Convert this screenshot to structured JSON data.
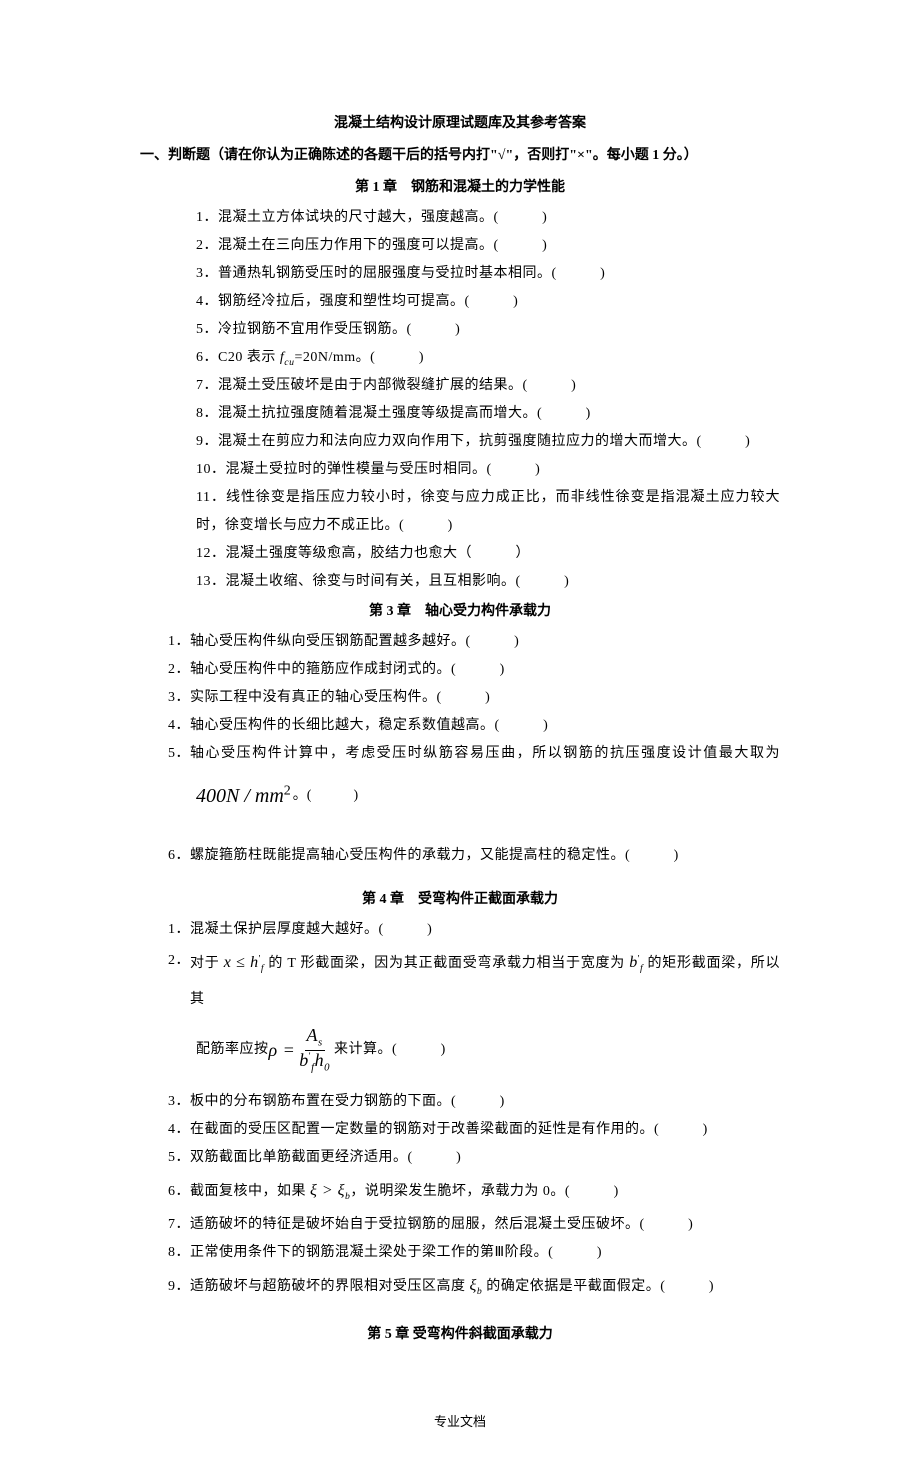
{
  "title": "混凝土结构设计原理试题库及其参考答案",
  "instruction": "一、判断题（请在你认为正确陈述的各题干后的括号内打\"√\"，否则打\"×\"。每小题 1 分。）",
  "chapter1": "第 1 章　钢筋和混凝土的力学性能",
  "c1": {
    "q1": "1．混凝土立方体试块的尺寸越大，强度越高。(　　　)",
    "q2": "2．混凝土在三向压力作用下的强度可以提高。(　　　)",
    "q3": "3．普通热轧钢筋受压时的屈服强度与受拉时基本相同。(　　　)",
    "q4": "4．钢筋经冷拉后，强度和塑性均可提高。(　　　)",
    "q5": "5．冷拉钢筋不宜用作受压钢筋。(　　　)",
    "q6_a": "6．C20 表示 ",
    "q6_fcu": "f",
    "q6_sub": "cu",
    "q6_b": "=20N/mm。(　　　)",
    "q7": "7．混凝土受压破坏是由于内部微裂缝扩展的结果。(　　　)",
    "q8": "8．混凝土抗拉强度随着混凝土强度等级提高而增大。(　　　)",
    "q9": "9．混凝土在剪应力和法向应力双向作用下，抗剪强度随拉应力的增大而增大。(　　　)",
    "q10": "10．混凝土受拉时的弹性模量与受压时相同。(　　　)",
    "q11": "11．线性徐变是指压应力较小时，徐变与应力成正比，而非线性徐变是指混凝土应力较大时，徐变增长与应力不成正比。(　　　)",
    "q12": "12．混凝土强度等级愈高，胶结力也愈大（　　　）",
    "q13": "13．混凝土收缩、徐变与时间有关，且互相影响。(　　　)"
  },
  "chapter3": "第 3 章　轴心受力构件承载力",
  "c3": {
    "q1": "轴心受压构件纵向受压钢筋配置越多越好。(　　　)",
    "q2": "轴心受压构件中的箍筋应作成封闭式的。(　　　)",
    "q3": "实际工程中没有真正的轴心受压构件。(　　　)",
    "q4": "轴心受压构件的长细比越大，稳定系数值越高。(　　　)",
    "q5_a": "轴心受压构件计算中，考虑受压时纵筋容易压曲，所以钢筋的抗压强度设计值最大取为",
    "q5_formula": "400N / mm",
    "q5_sup": "2",
    "q5_b": "。(　　　)",
    "q6": "6．螺旋箍筋柱既能提高轴心受压构件的承载力，又能提高柱的稳定性。(　　　)"
  },
  "chapter4": "第 4 章　受弯构件正截面承载力",
  "c4": {
    "q1": "混凝土保护层厚度越大越好。(　　　)",
    "q2_a": "对于 ",
    "q2_x": "x ≤ h",
    "q2_x_sub": "f",
    "q2_b": " 的 T 形截面梁，因为其正截面受弯承载力相当于宽度为 ",
    "q2_bf": "b",
    "q2_bf_sub": "f",
    "q2_c": " 的矩形截面梁，所以其",
    "q2_d": "配筋率应按 ",
    "q2_rho": "ρ =",
    "q2_num": "A",
    "q2_num_sub": "s",
    "q2_den_a": "b",
    "q2_den_sub": "f",
    "q2_den_b": "h",
    "q2_den_sub2": "0",
    "q2_e": " 来计算。(　　　)",
    "q3": "板中的分布钢筋布置在受力钢筋的下面。(　　　)",
    "q4": "在截面的受压区配置一定数量的钢筋对于改善梁截面的延性是有作用的。(　　　)",
    "q5": "双筋截面比单筋截面更经济适用。(　　　)",
    "q6_a": "截面复核中，如果 ",
    "q6_xi": "ξ > ξ",
    "q6_xi_sub": "b",
    "q6_b": "，说明梁发生脆坏，承载力为 0。(　　　)",
    "q7": "适筋破坏的特征是破坏始自于受拉钢筋的屈服，然后混凝土受压破坏。(　　　)",
    "q8": "正常使用条件下的钢筋混凝土梁处于梁工作的第Ⅲ阶段。(　　　)",
    "q9_a": "适筋破坏与超筋破坏的界限相对受压区高度 ",
    "q9_xi": "ξ",
    "q9_xi_sub": "b",
    "q9_b": " 的确定依据是平截面假定。(　　　)"
  },
  "chapter5": "第 5 章  受弯构件斜截面承载力",
  "labels": {
    "n1": "1．",
    "n2": "2．",
    "n3": "3．",
    "n4": "4．",
    "n5": "5．",
    "n6": "6．",
    "n7": "7．",
    "n8": "8．",
    "n9": "9．"
  },
  "footer": "专业文档"
}
